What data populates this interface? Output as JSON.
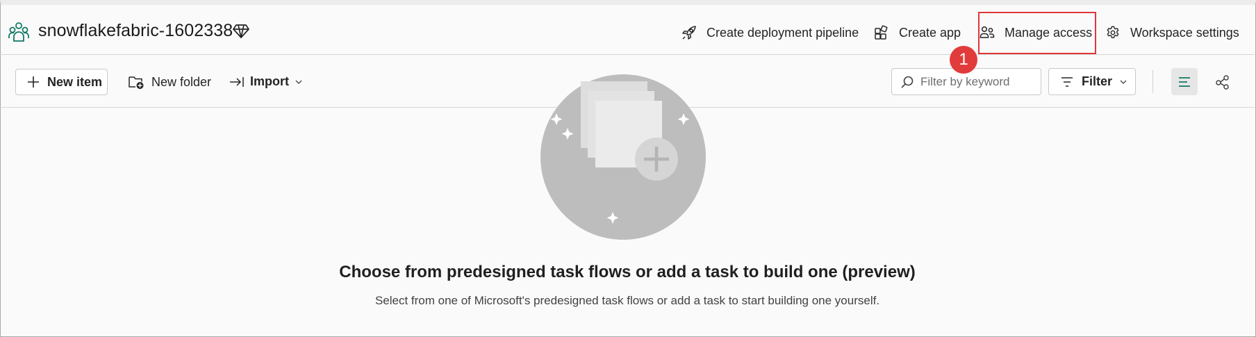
{
  "workspace": {
    "name": "snowflakefabric-1602338",
    "logo_icon": "workspace-people-icon",
    "badge_icon": "premium-diamond-icon"
  },
  "header_actions": {
    "deploy": {
      "label": "Create deployment pipeline",
      "icon": "rocket-icon"
    },
    "app": {
      "label": "Create app",
      "icon": "app-grid-icon"
    },
    "access": {
      "label": "Manage access",
      "icon": "people-icon"
    },
    "settings": {
      "label": "Workspace settings",
      "icon": "gear-icon"
    }
  },
  "annotation": {
    "step_number": "1",
    "highlight_color": "#e0363a",
    "badge_color": "#e23b3b"
  },
  "toolbar": {
    "new_item": "New item",
    "new_folder": "New folder",
    "import": "Import",
    "search_placeholder": "Filter by keyword",
    "filter": "Filter"
  },
  "empty_state": {
    "title": "Choose from predesigned task flows or add a task to build one (preview)",
    "subtitle": "Select from one of Microsoft's predesigned task flows or add a task to start building one yourself."
  },
  "colors": {
    "accent": "#117865",
    "background": "#fafafa",
    "illustration_circle": "#bdbdbd"
  }
}
